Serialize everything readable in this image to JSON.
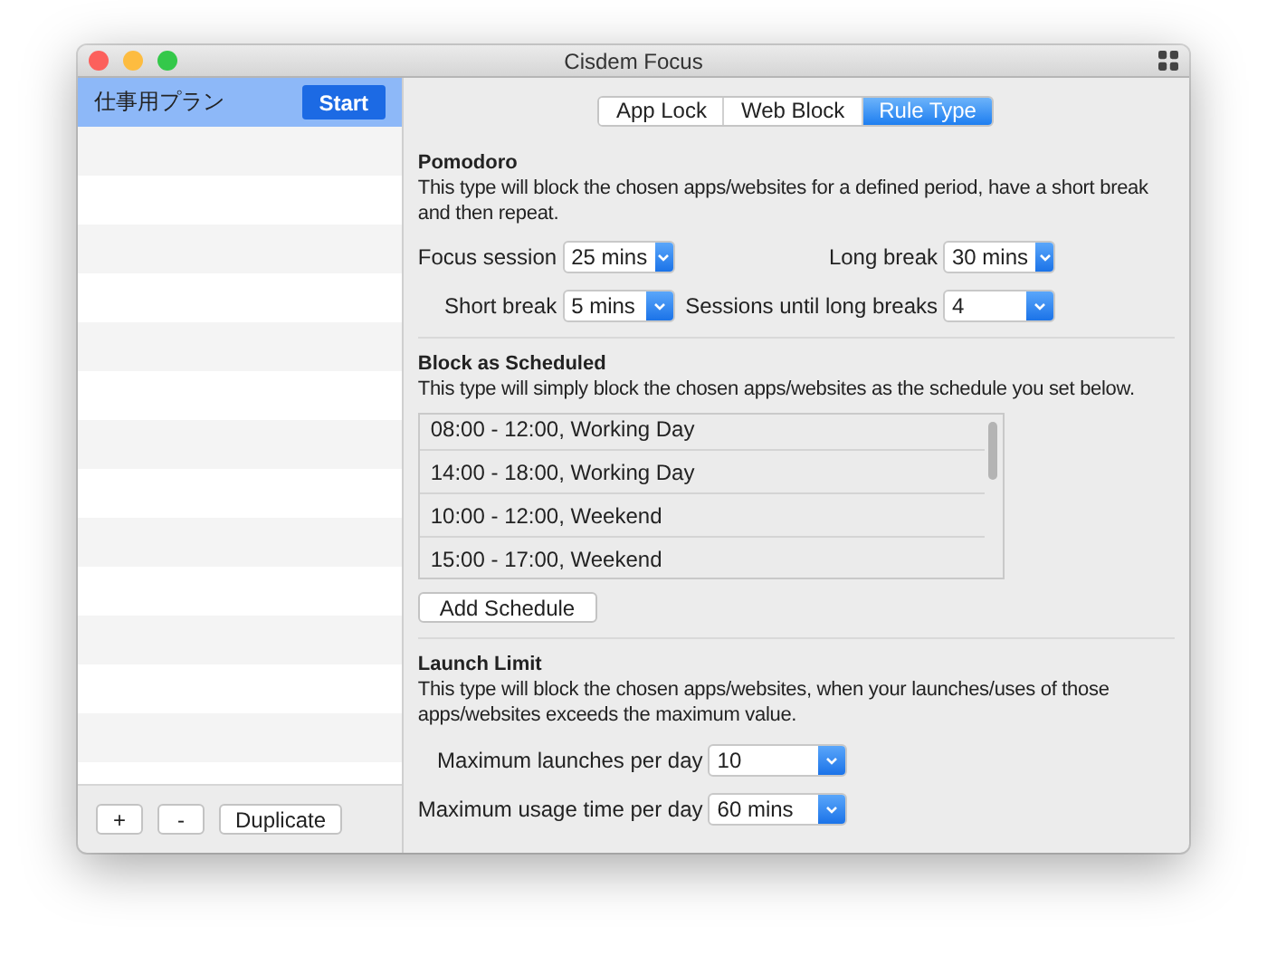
{
  "window": {
    "title": "Cisdem Focus"
  },
  "plans": [
    {
      "name": "仕事用プラン",
      "selected": true,
      "action": "Start"
    }
  ],
  "sidebar_buttons": [
    "+",
    "-",
    "Duplicate"
  ],
  "tabs": [
    {
      "label": "App Lock",
      "selected": false
    },
    {
      "label": "Web Block",
      "selected": false
    },
    {
      "label": "Rule Type",
      "selected": true
    }
  ],
  "pomodoro": {
    "title": "Pomodoro",
    "description": "This type will block the chosen apps/websites for a defined period, have a short break and then repeat.",
    "settings": [
      {
        "label": "Focus session",
        "value": "25 mins"
      },
      {
        "label": "Long break",
        "value": "30 mins"
      },
      {
        "label": "Short break",
        "value": "5 mins"
      },
      {
        "label": "Sessions until long breaks",
        "value": "4"
      }
    ]
  },
  "schedule": {
    "title": "Block as Scheduled",
    "description": "This type will simply block the chosen apps/websites as the schedule you set below.",
    "entries": [
      "08:00 - 12:00, Working Day",
      "14:00 - 18:00, Working Day",
      "10:00 - 12:00, Weekend",
      "15:00 - 17:00, Weekend"
    ],
    "add_button": "Add Schedule"
  },
  "launch_limit": {
    "title": "Launch Limit",
    "description": "This type will block the chosen apps/websites, when your launches/uses of those apps/websites exceeds the maximum value.",
    "settings": [
      {
        "label": "Maximum launches per day",
        "value": "10"
      },
      {
        "label": "Maximum usage time per day",
        "value": "60 mins"
      }
    ]
  }
}
